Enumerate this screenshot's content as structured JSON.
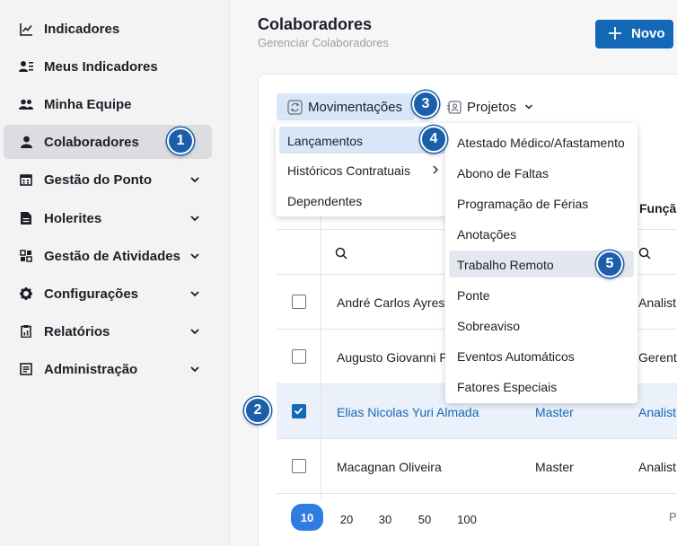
{
  "sidebar": {
    "items": [
      {
        "label": "Indicadores",
        "icon": "chart-line-icon",
        "expandable": false,
        "active": false
      },
      {
        "label": "Meus Indicadores",
        "icon": "user-list-icon",
        "expandable": false,
        "active": false
      },
      {
        "label": "Minha Equipe",
        "icon": "users-icon",
        "expandable": false,
        "active": false
      },
      {
        "label": "Colaboradores",
        "icon": "user-icon",
        "expandable": false,
        "active": true
      },
      {
        "label": "Gestão do Ponto",
        "icon": "calendar-icon",
        "expandable": true,
        "active": false
      },
      {
        "label": "Holerites",
        "icon": "document-icon",
        "expandable": true,
        "active": false
      },
      {
        "label": "Gestão de Atividades",
        "icon": "grid-icon",
        "expandable": true,
        "active": false
      },
      {
        "label": "Configurações",
        "icon": "gear-icon",
        "expandable": true,
        "active": false
      },
      {
        "label": "Relatórios",
        "icon": "report-icon",
        "expandable": true,
        "active": false
      },
      {
        "label": "Administração",
        "icon": "admin-icon",
        "expandable": true,
        "active": false
      }
    ]
  },
  "header": {
    "title": "Colaboradores",
    "subtitle": "Gerenciar Colaboradores",
    "new_button": "Novo"
  },
  "tabs": {
    "movimentacoes": "Movimentações",
    "projetos": "Projetos"
  },
  "menu_movimentacoes": {
    "items": [
      {
        "label": "Lançamentos",
        "highlighted": true,
        "submenu": false
      },
      {
        "label": "Históricos Contratuais",
        "highlighted": false,
        "submenu": true
      },
      {
        "label": "Dependentes",
        "highlighted": false,
        "submenu": false
      }
    ]
  },
  "menu_lancamentos": {
    "items": [
      {
        "label": "Atestado Médico/Afastamento",
        "highlighted": false
      },
      {
        "label": "Abono de Faltas",
        "highlighted": false
      },
      {
        "label": "Programação de Férias",
        "highlighted": false
      },
      {
        "label": "Anotações",
        "highlighted": false
      },
      {
        "label": "Trabalho Remoto",
        "highlighted": true
      },
      {
        "label": "Ponte",
        "highlighted": false
      },
      {
        "label": "Sobreaviso",
        "highlighted": false
      },
      {
        "label": "Eventos Automáticos",
        "highlighted": false
      },
      {
        "label": "Fatores Especiais",
        "highlighted": false
      }
    ]
  },
  "table": {
    "column_funcao": "Funçã",
    "rows": [
      {
        "name": "André Carlos Ayres",
        "group": "",
        "funcao": "Analist",
        "checked": false
      },
      {
        "name": "Augusto Giovanni Pe",
        "group": "",
        "funcao": "Gerent",
        "checked": false
      },
      {
        "name": "Elias Nicolas Yuri Almada",
        "group": "Master",
        "funcao": "Analist",
        "checked": true
      },
      {
        "name": "Macagnan Oliveira",
        "group": "Master",
        "funcao": "Analist",
        "checked": false
      }
    ]
  },
  "pagination": {
    "sizes": [
      "10",
      "20",
      "30",
      "50",
      "100"
    ],
    "active": "10",
    "right_label": "P"
  },
  "callouts": [
    "1",
    "2",
    "3",
    "4",
    "5"
  ],
  "colors": {
    "accent": "#1468b8",
    "active_nav": "#dcdde1",
    "tab_highlight": "#d9e6f7",
    "badge": "#1a5fa8"
  }
}
